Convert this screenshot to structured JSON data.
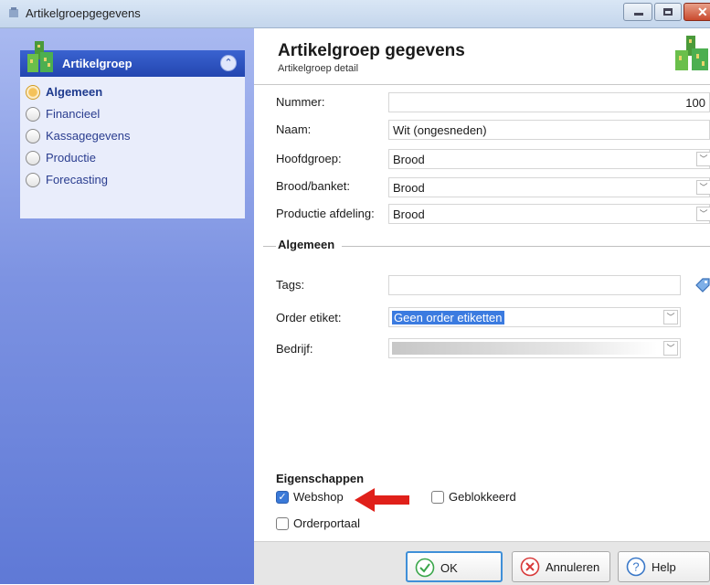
{
  "window": {
    "title": "Artikelgroepgegevens"
  },
  "sidebar": {
    "header": "Artikelgroep",
    "items": [
      {
        "label": "Algemeen",
        "active": true
      },
      {
        "label": "Financieel",
        "active": false
      },
      {
        "label": "Kassagegevens",
        "active": false
      },
      {
        "label": "Productie",
        "active": false
      },
      {
        "label": "Forecasting",
        "active": false
      }
    ]
  },
  "header": {
    "title": "Artikelgroep gegevens",
    "subtitle": "Artikelgroep detail"
  },
  "form": {
    "nummer": {
      "label": "Nummer:",
      "value": "100"
    },
    "naam": {
      "label": "Naam:",
      "value": "Wit (ongesneden)"
    },
    "hoofdgroep": {
      "label": "Hoofdgroep:",
      "value": "Brood"
    },
    "brood_banket": {
      "label": "Brood/banket:",
      "value": "Brood"
    },
    "productie_afdeling": {
      "label": "Productie afdeling:",
      "value": "Brood"
    }
  },
  "algemeen": {
    "title": "Algemeen",
    "tags": {
      "label": "Tags:",
      "value": ""
    },
    "order_etiket": {
      "label": "Order etiket:",
      "value": "Geen order etiketten"
    },
    "bedrijf": {
      "label": "Bedrijf:",
      "value": ""
    }
  },
  "eigenschappen": {
    "title": "Eigenschappen",
    "webshop": {
      "label": "Webshop",
      "checked": true
    },
    "geblokkeerd": {
      "label": "Geblokkeerd",
      "checked": false
    },
    "orderportaal": {
      "label": "Orderportaal",
      "checked": false
    }
  },
  "footer": {
    "ok": "OK",
    "annuleren": "Annuleren",
    "help": "Help"
  },
  "colors": {
    "accent": "#3a63d0",
    "arrow": "#e0201a",
    "selection": "#3b7be0"
  }
}
